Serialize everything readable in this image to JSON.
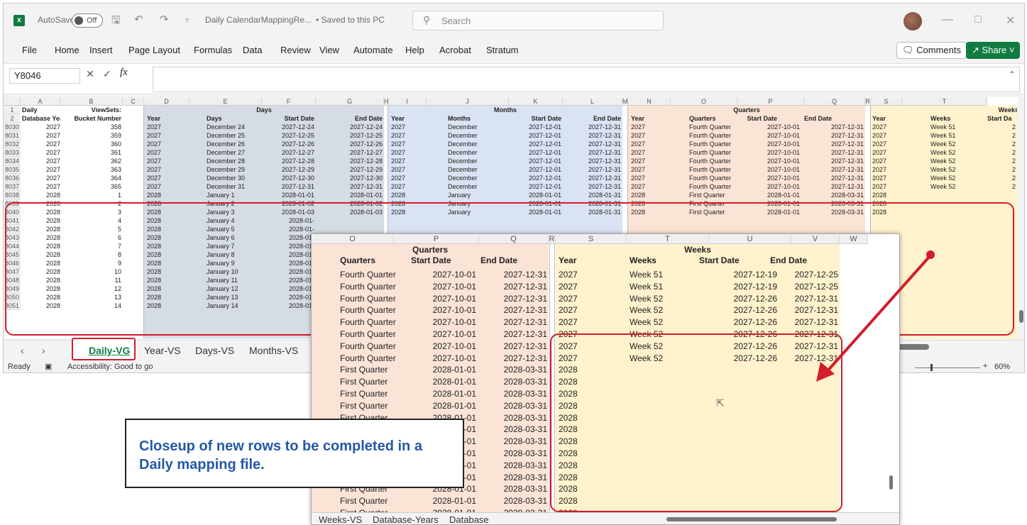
{
  "titlebar": {
    "autosave_label": "AutoSave",
    "autosave_state": "Off",
    "doc_title": "Daily CalendarMappingRe...",
    "saved_status": "• Saved to this PC",
    "search_placeholder": "Search"
  },
  "menu": [
    "File",
    "Home",
    "Insert",
    "Page Layout",
    "Formulas",
    "Data",
    "Review",
    "View",
    "Automate",
    "Help",
    "Acrobat",
    "Stratum"
  ],
  "ribbon": {
    "comments_label": "Comments",
    "share_label": "Share"
  },
  "formula_bar": {
    "name_box": "Y8046",
    "fx": "fx",
    "value": ""
  },
  "columns": [
    "A",
    "B",
    "C",
    "D",
    "E",
    "F",
    "G",
    "H",
    "I",
    "J",
    "K",
    "L",
    "M",
    "N",
    "O",
    "P",
    "Q",
    "R",
    "S",
    "T"
  ],
  "header_row1": {
    "r1": "1",
    "a": "Daily",
    "b": "ViewSets:",
    "days": "Days",
    "months": "Months",
    "quarters": "Quarters",
    "weeks": "Weeks"
  },
  "header_row2": {
    "r2": "2",
    "a": "Database Year",
    "b": "Bucket Number",
    "d": "Year",
    "e": "Days",
    "f": "Start Date",
    "g": "End Date",
    "i": "Year",
    "j": "Months",
    "k": "Start Date",
    "l": "End Date",
    "n": "Year",
    "o": "Quarters",
    "p": "Start Date",
    "q": "End Date",
    "s": "Year",
    "t": "Weeks",
    "u": "Start Da"
  },
  "rows": [
    {
      "n": "8030",
      "a": "2027",
      "b": "358",
      "d": "2027",
      "e": "December 24",
      "f": "2027-12-24",
      "g": "2027-12-24",
      "i": "2027",
      "j": "December",
      "k": "2027-12-01",
      "l": "2027-12-31",
      "nn": "2027",
      "o": "Fourth Quarter",
      "p": "2027-10-01",
      "q": "2027-12-31",
      "s": "2027",
      "t": "Week 51",
      "u": "2"
    },
    {
      "n": "8031",
      "a": "2027",
      "b": "359",
      "d": "2027",
      "e": "December 25",
      "f": "2027-12-25",
      "g": "2027-12-25",
      "i": "2027",
      "j": "December",
      "k": "2027-12-01",
      "l": "2027-12-31",
      "nn": "2027",
      "o": "Fourth Quarter",
      "p": "2027-10-01",
      "q": "2027-12-31",
      "s": "2027",
      "t": "Week 51",
      "u": "2"
    },
    {
      "n": "8032",
      "a": "2027",
      "b": "360",
      "d": "2027",
      "e": "December 26",
      "f": "2027-12-26",
      "g": "2027-12-26",
      "i": "2027",
      "j": "December",
      "k": "2027-12-01",
      "l": "2027-12-31",
      "nn": "2027",
      "o": "Fourth Quarter",
      "p": "2027-10-01",
      "q": "2027-12-31",
      "s": "2027",
      "t": "Week 52",
      "u": "2"
    },
    {
      "n": "8033",
      "a": "2027",
      "b": "361",
      "d": "2027",
      "e": "December 27",
      "f": "2027-12-27",
      "g": "2027-12-27",
      "i": "2027",
      "j": "December",
      "k": "2027-12-01",
      "l": "2027-12-31",
      "nn": "2027",
      "o": "Fourth Quarter",
      "p": "2027-10-01",
      "q": "2027-12-31",
      "s": "2027",
      "t": "Week 52",
      "u": "2"
    },
    {
      "n": "8034",
      "a": "2027",
      "b": "362",
      "d": "2027",
      "e": "December 28",
      "f": "2027-12-28",
      "g": "2027-12-28",
      "i": "2027",
      "j": "December",
      "k": "2027-12-01",
      "l": "2027-12-31",
      "nn": "2027",
      "o": "Fourth Quarter",
      "p": "2027-10-01",
      "q": "2027-12-31",
      "s": "2027",
      "t": "Week 52",
      "u": "2"
    },
    {
      "n": "8035",
      "a": "2027",
      "b": "363",
      "d": "2027",
      "e": "December 29",
      "f": "2027-12-29",
      "g": "2027-12-29",
      "i": "2027",
      "j": "December",
      "k": "2027-12-01",
      "l": "2027-12-31",
      "nn": "2027",
      "o": "Fourth Quarter",
      "p": "2027-10-01",
      "q": "2027-12-31",
      "s": "2027",
      "t": "Week 52",
      "u": "2"
    },
    {
      "n": "8036",
      "a": "2027",
      "b": "364",
      "d": "2027",
      "e": "December 30",
      "f": "2027-12-30",
      "g": "2027-12-30",
      "i": "2027",
      "j": "December",
      "k": "2027-12-01",
      "l": "2027-12-31",
      "nn": "2027",
      "o": "Fourth Quarter",
      "p": "2027-10-01",
      "q": "2027-12-31",
      "s": "2027",
      "t": "Week 52",
      "u": "2"
    },
    {
      "n": "8037",
      "a": "2027",
      "b": "365",
      "d": "2027",
      "e": "December 31",
      "f": "2027-12-31",
      "g": "2027-12-31",
      "i": "2027",
      "j": "December",
      "k": "2027-12-01",
      "l": "2027-12-31",
      "nn": "2027",
      "o": "Fourth Quarter",
      "p": "2027-10-01",
      "q": "2027-12-31",
      "s": "2027",
      "t": "Week 52",
      "u": "2"
    },
    {
      "n": "8038",
      "a": "2028",
      "b": "1",
      "d": "2028",
      "e": "January 1",
      "f": "2028-01-01",
      "g": "2028-01-01",
      "i": "2028",
      "j": "January",
      "k": "2028-01-01",
      "l": "2028-01-31",
      "nn": "2028",
      "o": "First Quarter",
      "p": "2028-01-01",
      "q": "2028-03-31",
      "s": "2028",
      "t": "",
      "u": ""
    },
    {
      "n": "8039",
      "a": "2028",
      "b": "2",
      "d": "2028",
      "e": "January 2",
      "f": "2028-01-02",
      "g": "2028-01-02",
      "i": "2028",
      "j": "January",
      "k": "2028-01-01",
      "l": "2028-01-31",
      "nn": "2028",
      "o": "First Quarter",
      "p": "2028-01-01",
      "q": "2028-03-31",
      "s": "2028",
      "t": "",
      "u": ""
    },
    {
      "n": "8040",
      "a": "2028",
      "b": "3",
      "d": "2028",
      "e": "January 3",
      "f": "2028-01-03",
      "g": "2028-01-03",
      "i": "2028",
      "j": "January",
      "k": "2028-01-01",
      "l": "2028-01-31",
      "nn": "2028",
      "o": "First Quarter",
      "p": "2028-01-01",
      "q": "2028-03-31",
      "s": "2028",
      "t": "",
      "u": ""
    },
    {
      "n": "8041",
      "a": "2028",
      "b": "4",
      "d": "2028",
      "e": "January 4",
      "f": "2028-01-",
      "g": "",
      "i": "",
      "j": "",
      "k": "",
      "l": "",
      "nn": "",
      "o": "",
      "p": "",
      "q": "",
      "s": "",
      "t": "",
      "u": ""
    },
    {
      "n": "8042",
      "a": "2028",
      "b": "5",
      "d": "2028",
      "e": "January 5",
      "f": "2028-01-",
      "g": "",
      "i": "",
      "j": "",
      "k": "",
      "l": "",
      "nn": "",
      "o": "",
      "p": "",
      "q": "",
      "s": "",
      "t": "",
      "u": ""
    },
    {
      "n": "8043",
      "a": "2028",
      "b": "6",
      "d": "2028",
      "e": "January 6",
      "f": "2028-01-",
      "g": "",
      "i": "",
      "j": "",
      "k": "",
      "l": "",
      "nn": "",
      "o": "",
      "p": "",
      "q": "",
      "s": "",
      "t": "",
      "u": ""
    },
    {
      "n": "8044",
      "a": "2028",
      "b": "7",
      "d": "2028",
      "e": "January 7",
      "f": "2028-01-",
      "g": "",
      "i": "",
      "j": "",
      "k": "",
      "l": "",
      "nn": "",
      "o": "",
      "p": "",
      "q": "",
      "s": "",
      "t": "",
      "u": ""
    },
    {
      "n": "8045",
      "a": "2028",
      "b": "8",
      "d": "2028",
      "e": "January 8",
      "f": "2028-01-",
      "g": "",
      "i": "",
      "j": "",
      "k": "",
      "l": "",
      "nn": "",
      "o": "",
      "p": "",
      "q": "",
      "s": "",
      "t": "",
      "u": ""
    },
    {
      "n": "8046",
      "a": "2028",
      "b": "9",
      "d": "2028",
      "e": "January 9",
      "f": "2028-01-",
      "g": "",
      "i": "",
      "j": "",
      "k": "",
      "l": "",
      "nn": "",
      "o": "",
      "p": "",
      "q": "",
      "s": "",
      "t": "",
      "u": ""
    },
    {
      "n": "8047",
      "a": "2028",
      "b": "10",
      "d": "2028",
      "e": "January 10",
      "f": "2028-01-",
      "g": "",
      "i": "",
      "j": "",
      "k": "",
      "l": "",
      "nn": "",
      "o": "",
      "p": "",
      "q": "",
      "s": "",
      "t": "",
      "u": ""
    },
    {
      "n": "8048",
      "a": "2028",
      "b": "11",
      "d": "2028",
      "e": "January 11",
      "f": "2028-01-",
      "g": "",
      "i": "",
      "j": "",
      "k": "",
      "l": "",
      "nn": "",
      "o": "",
      "p": "",
      "q": "",
      "s": "",
      "t": "",
      "u": ""
    },
    {
      "n": "8049",
      "a": "2028",
      "b": "12",
      "d": "2028",
      "e": "January 12",
      "f": "2028-01-",
      "g": "",
      "i": "",
      "j": "",
      "k": "",
      "l": "",
      "nn": "",
      "o": "",
      "p": "",
      "q": "",
      "s": "",
      "t": "",
      "u": ""
    },
    {
      "n": "8050",
      "a": "2028",
      "b": "13",
      "d": "2028",
      "e": "January 13",
      "f": "2028-01-",
      "g": "",
      "i": "",
      "j": "",
      "k": "",
      "l": "",
      "nn": "",
      "o": "",
      "p": "",
      "q": "",
      "s": "",
      "t": "",
      "u": ""
    },
    {
      "n": "8051",
      "a": "2028",
      "b": "14",
      "d": "2028",
      "e": "January 14",
      "f": "2028-01-",
      "g": "",
      "i": "",
      "j": "",
      "k": "",
      "l": "",
      "nn": "",
      "o": "",
      "p": "",
      "q": "",
      "s": "",
      "t": "",
      "u": ""
    }
  ],
  "sheet_tabs": [
    "Daily-VG",
    "Year-VS",
    "Days-VS",
    "Months-VS"
  ],
  "status": {
    "ready": "Ready",
    "accessibility": "Accessibility: Good to go",
    "zoom": "60%"
  },
  "zoom_view": {
    "columns": [
      "O",
      "P",
      "Q",
      "R",
      "S",
      "T",
      "U",
      "V",
      "W"
    ],
    "header1": {
      "quarters": "Quarters",
      "weeks": "Weeks"
    },
    "header2": {
      "quarters": "Quarters",
      "start": "Start Date",
      "end": "End Date",
      "year": "Year",
      "weeks": "Weeks",
      "wstart": "Start Date",
      "wend": "End Date"
    },
    "rows": [
      {
        "o": "Fourth Quarter",
        "p": "2027-10-01",
        "q": "2027-12-31",
        "s": "2027",
        "t": "Week 51",
        "u": "2027-12-19",
        "v": "2027-12-25"
      },
      {
        "o": "Fourth Quarter",
        "p": "2027-10-01",
        "q": "2027-12-31",
        "s": "2027",
        "t": "Week 51",
        "u": "2027-12-19",
        "v": "2027-12-25"
      },
      {
        "o": "Fourth Quarter",
        "p": "2027-10-01",
        "q": "2027-12-31",
        "s": "2027",
        "t": "Week 52",
        "u": "2027-12-26",
        "v": "2027-12-31"
      },
      {
        "o": "Fourth Quarter",
        "p": "2027-10-01",
        "q": "2027-12-31",
        "s": "2027",
        "t": "Week 52",
        "u": "2027-12-26",
        "v": "2027-12-31"
      },
      {
        "o": "Fourth Quarter",
        "p": "2027-10-01",
        "q": "2027-12-31",
        "s": "2027",
        "t": "Week 52",
        "u": "2027-12-26",
        "v": "2027-12-31"
      },
      {
        "o": "Fourth Quarter",
        "p": "2027-10-01",
        "q": "2027-12-31",
        "s": "2027",
        "t": "Week 52",
        "u": "2027-12-26",
        "v": "2027-12-31"
      },
      {
        "o": "Fourth Quarter",
        "p": "2027-10-01",
        "q": "2027-12-31",
        "s": "2027",
        "t": "Week 52",
        "u": "2027-12-26",
        "v": "2027-12-31"
      },
      {
        "o": "Fourth Quarter",
        "p": "2027-10-01",
        "q": "2027-12-31",
        "s": "2027",
        "t": "Week 52",
        "u": "2027-12-26",
        "v": "2027-12-31"
      },
      {
        "o": "First Quarter",
        "p": "2028-01-01",
        "q": "2028-03-31",
        "s": "2028",
        "t": "",
        "u": "",
        "v": ""
      },
      {
        "o": "First Quarter",
        "p": "2028-01-01",
        "q": "2028-03-31",
        "s": "2028",
        "t": "",
        "u": "",
        "v": ""
      },
      {
        "o": "First Quarter",
        "p": "2028-01-01",
        "q": "2028-03-31",
        "s": "2028",
        "t": "",
        "u": "",
        "v": ""
      },
      {
        "o": "First Quarter",
        "p": "2028-01-01",
        "q": "2028-03-31",
        "s": "2028",
        "t": "",
        "u": "",
        "v": ""
      },
      {
        "o": "First Quarter",
        "p": "2028-01-01",
        "q": "2028-03-31",
        "s": "2028",
        "t": "",
        "u": "",
        "v": ""
      },
      {
        "o": "First Quarter",
        "p": "2028-01-01",
        "q": "2028-03-31",
        "s": "2028",
        "t": "",
        "u": "",
        "v": ""
      },
      {
        "o": "First Quarter",
        "p": "2028-01-01",
        "q": "2028-03-31",
        "s": "2028",
        "t": "",
        "u": "",
        "v": ""
      },
      {
        "o": "First Quarter",
        "p": "2028-01-01",
        "q": "2028-03-31",
        "s": "2028",
        "t": "",
        "u": "",
        "v": ""
      },
      {
        "o": "First Quarter",
        "p": "2028-01-01",
        "q": "2028-03-31",
        "s": "2028",
        "t": "",
        "u": "",
        "v": ""
      },
      {
        "o": "First Quarter",
        "p": "2028-01-01",
        "q": "2028-03-31",
        "s": "2028",
        "t": "",
        "u": "",
        "v": ""
      },
      {
        "o": "First Quarter",
        "p": "2028-01-01",
        "q": "2028-03-31",
        "s": "2028",
        "t": "",
        "u": "",
        "v": ""
      },
      {
        "o": "First Quarter",
        "p": "2028-01-01",
        "q": "2028-03-31",
        "s": "2028",
        "t": "",
        "u": "",
        "v": ""
      },
      {
        "o": "First Quarter",
        "p": "2028-01-01",
        "q": "2028-03-31",
        "s": "2028",
        "t": "",
        "u": "",
        "v": ""
      },
      {
        "o": "First Quarter",
        "p": "2028-01-01",
        "q": "2028-03-31",
        "s": "2028",
        "t": "",
        "u": "",
        "v": ""
      }
    ],
    "tabs": [
      "Weeks-VS",
      "Database-Years",
      "Database"
    ]
  },
  "callout": "Closeup of new rows to be completed in a Daily mapping file.",
  "colors": {
    "days_fill": "#d6dce4",
    "months_fill": "#dae3f3",
    "quarters_fill": "#fbe3d6",
    "weeks_fill": "#fff2cc",
    "highlight": "#d21d2a",
    "excel_green": "#107c41",
    "callout_text": "#2458a6"
  }
}
